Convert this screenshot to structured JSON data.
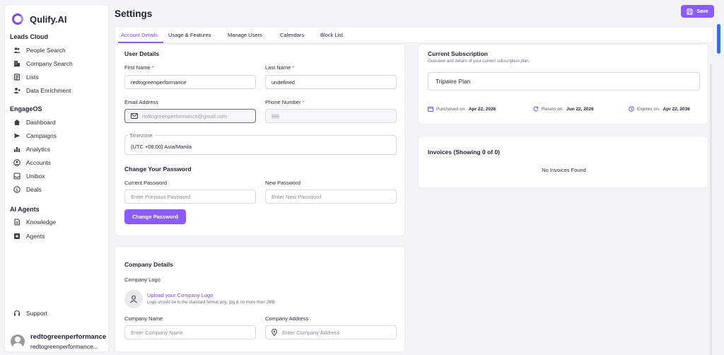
{
  "app": {
    "name": "Qulify.AI"
  },
  "sidebar": {
    "sections": [
      {
        "title": "Leads Cloud",
        "items": [
          {
            "label": "People Search",
            "icon": "people-icon"
          },
          {
            "label": "Company Search",
            "icon": "building-icon"
          },
          {
            "label": "Lists",
            "icon": "list-icon"
          },
          {
            "label": "Data Enrichment",
            "icon": "user-plus-icon"
          }
        ]
      },
      {
        "title": "EngageOS",
        "items": [
          {
            "label": "Dashboard",
            "icon": "home-icon"
          },
          {
            "label": "Campaigns",
            "icon": "send-icon"
          },
          {
            "label": "Analytics",
            "icon": "bar-chart-icon"
          },
          {
            "label": "Accounts",
            "icon": "account-circle-icon"
          },
          {
            "label": "Unibox",
            "icon": "inbox-icon"
          },
          {
            "label": "Deals",
            "icon": "dollar-icon"
          }
        ]
      },
      {
        "title": "AI Agents",
        "items": [
          {
            "label": "Knowledge",
            "icon": "document-icon"
          },
          {
            "label": "Agents",
            "icon": "agent-icon"
          }
        ]
      }
    ],
    "support": "Support",
    "user": {
      "name": "redtogreenperformance",
      "email": "redtogreenperformance..."
    }
  },
  "header": {
    "title": "Settings",
    "save_label": "Save"
  },
  "tabs": [
    "Account Details",
    "Usage & Features",
    "Manage Users",
    "Calendars",
    "Block List"
  ],
  "user_details": {
    "title": "User Details",
    "first_name_label": "First Name",
    "first_name_value": "redtogreenperformance",
    "last_name_label": "Last Name",
    "last_name_value": "undefined",
    "email_label": "Email Address",
    "email_value": "redtogreenperformance@gmail.com",
    "phone_label": "Phone Number",
    "timezone_label": "Timezone",
    "timezone_value": "(UTC +08:00) Asia/Manila",
    "required_mark": "*"
  },
  "password": {
    "title": "Change Your Password",
    "current_label": "Current Password",
    "current_placeholder": "Enter Previous Password",
    "new_label": "New Password",
    "new_placeholder": "Enter New Password",
    "button": "Change Password"
  },
  "company": {
    "title": "Company Details",
    "logo_label": "Company Logo",
    "upload_link": "Upload your Company Logo",
    "upload_hint": "Logo should be in the standard format png, jpg & no more than 2MB",
    "name_label": "Company Name",
    "name_placeholder": "Enter Company Name",
    "address_label": "Company Address",
    "address_placeholder": "Enter Company Address"
  },
  "subscription": {
    "title": "Current Subscription",
    "subtitle": "Overview and details of your current subscription plan.",
    "plan": "Tripwire Plan",
    "purchased_label": "Purchased on:",
    "purchased_value": "Apr 22, 2026",
    "resets_label": "Resets on:",
    "resets_value": "Jun 22, 2026",
    "expires_label": "Expires on:",
    "expires_value": "Apr 22, 2036"
  },
  "invoices": {
    "title": "Invoices (Showing 0 of 0)",
    "empty": "No Invoices Found"
  },
  "colors": {
    "accent": "#8b5cf6",
    "required": "#e23b3b"
  }
}
